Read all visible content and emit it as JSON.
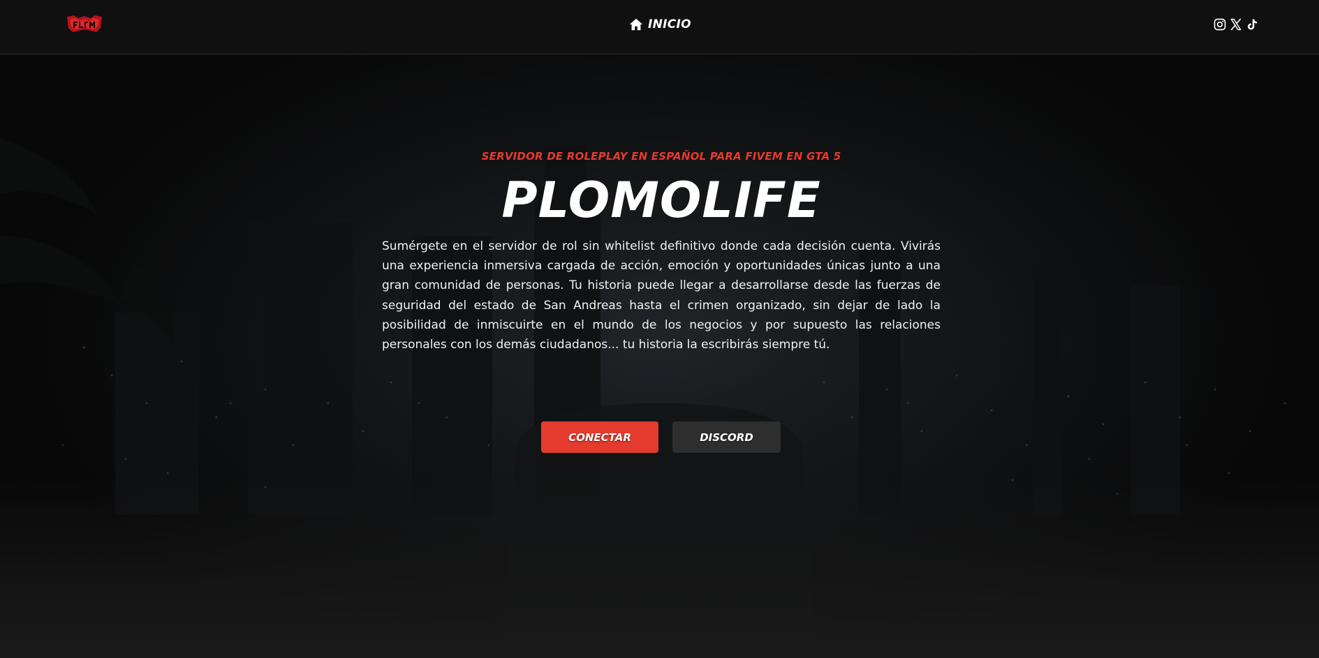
{
  "header": {
    "logo_icon": "plomolife-logo-icon",
    "nav": {
      "home_icon": "home-icon",
      "home_label": "INICIO"
    },
    "social_icons": [
      "instagram-icon",
      "x-icon",
      "tiktok-icon"
    ]
  },
  "hero": {
    "tagline": "SERVIDOR DE ROLEPLAY EN ESPAÑOL PARA FIVEM EN GTA 5",
    "title": "PLOMOLIFE",
    "description": "Sumérgete en el servidor de rol sin whitelist definitivo donde cada decisión cuenta. Vivirás una experiencia inmersiva cargada de acción, emoción y oportunidades únicas junto a una gran comunidad de personas. Tu historia puede llegar a desarrollarse desde las fuerzas de seguridad del estado de San Andreas hasta el crimen organizado, sin dejar de lado la posibilidad de inmiscuirte en el mundo de los negocios y por supuesto las relaciones personales con los demás ciudadanos... tu historia la escribirás siempre tú.",
    "buttons": {
      "connect_label": "CONECTAR",
      "discord_label": "DISCORD"
    }
  },
  "colors": {
    "accent": "#e53b2e",
    "navbar_bg": "#101010",
    "secondary_button": "#2e2e2e"
  }
}
